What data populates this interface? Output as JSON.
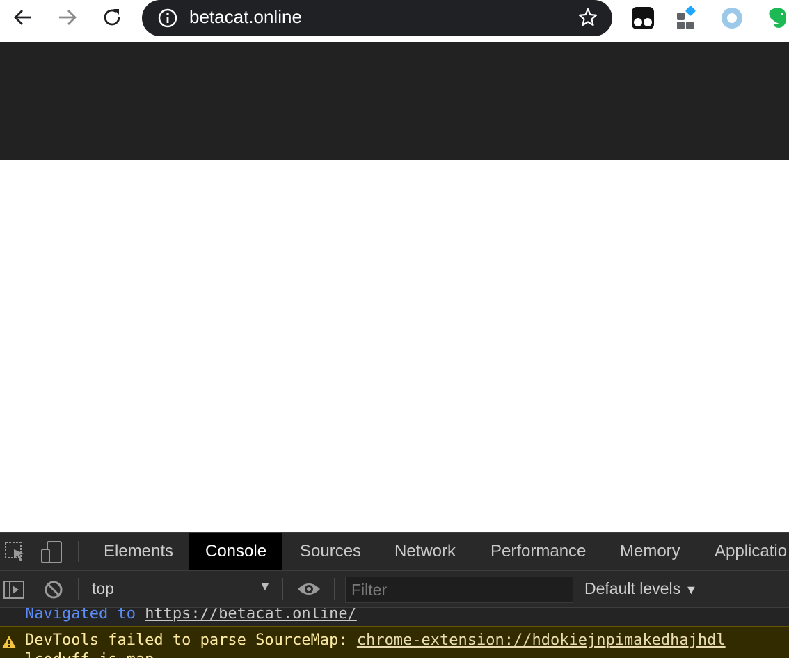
{
  "browser": {
    "url": "betacat.online",
    "nav": {
      "back": "back-arrow",
      "forward": "forward-arrow",
      "reload": "reload"
    }
  },
  "devtools": {
    "tabs": [
      {
        "label": "Elements"
      },
      {
        "label": "Console"
      },
      {
        "label": "Sources"
      },
      {
        "label": "Network"
      },
      {
        "label": "Performance"
      },
      {
        "label": "Memory"
      },
      {
        "label": "Applicatio"
      }
    ],
    "active_tab": "Console",
    "context": "top",
    "filter_placeholder": "Filter",
    "levels": "Default levels",
    "messages": {
      "navigated_prefix": "Navigated to ",
      "navigated_url": "https://betacat.online/",
      "warning_prefix": "DevTools failed to parse SourceMap: ",
      "warning_url": "chrome-extension://hdokiejnpimakedhajhdl",
      "warning_tail": "lcodyff.js.map"
    }
  },
  "colors": {
    "banner": "#222222",
    "devtools_bg": "#242424",
    "accent_link": "#5b8bf5",
    "warning_bg": "#332b00"
  }
}
